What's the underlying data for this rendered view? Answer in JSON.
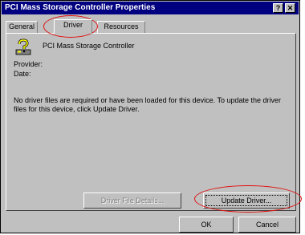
{
  "window": {
    "title": "PCI Mass Storage Controller Properties",
    "help_button": "?",
    "close_button": "✕"
  },
  "tabs": [
    {
      "label": "General"
    },
    {
      "label": "Driver"
    },
    {
      "label": "Resources"
    }
  ],
  "driver_tab": {
    "device_icon": "question-mark-icon",
    "device_name": "PCI Mass Storage Controller",
    "provider_label": "Provider:",
    "date_label": "Date:",
    "message": "No driver files are required or have been loaded for this device.  To update the driver files for this device, click Update Driver.",
    "driver_file_details_button": "Driver File Details...",
    "update_driver_button": "Update Driver..."
  },
  "footer": {
    "ok_button": "OK",
    "cancel_button": "Cancel"
  },
  "colors": {
    "titlebar": "#000080",
    "face": "#c0c0c0",
    "annotation": "#e01010"
  }
}
